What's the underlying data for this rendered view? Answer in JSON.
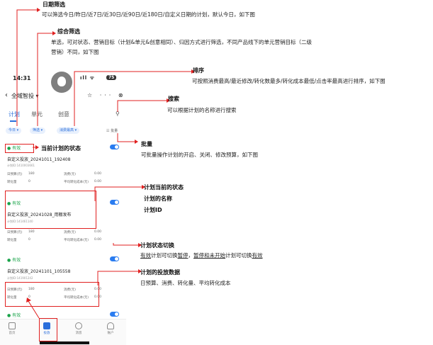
{
  "annotations": {
    "date_filter": {
      "title": "日期筛选",
      "desc": "可以筛选今日/昨日/近7日/近30日/近90日/近180日/自定义日期的计划，默认今日，如下图"
    },
    "combined_filter": {
      "title": "综合筛选",
      "desc1": "单选，可对状态、营销目标（计划&单元&创意相同）、归因方式进行筛选，不同产品线下的单元营销目标（二级",
      "desc2": "营销）不同，如下图"
    },
    "sort": {
      "title": "排序",
      "desc": "可按照消费最高/最近修改/转化数最多/转化成本最低/点击率最高进行排序，如下图"
    },
    "search": {
      "title": "搜索",
      "desc": "可以根据计划的名称进行搜索"
    },
    "current_status": "当前计划的状态",
    "batch": {
      "title": "批量",
      "desc": "可批量操作计划的开启、关闭、修改预算，如下图"
    },
    "plan_info": {
      "line1": "计划当前的状态",
      "line2": "计划的名称",
      "line3": "计划ID"
    },
    "toggle_switch": {
      "title": "计划状态切换",
      "desc_a": "有效",
      "desc_b": "计划可切换",
      "desc_c": "暂停",
      "desc_d": "，",
      "desc_e": "暂停和未开始",
      "desc_f": "计划可切换",
      "desc_g": "有效"
    },
    "delivery_data": {
      "title": "计划的投放数据",
      "desc": "日预算、消费、转化量、平均转化成本"
    }
  },
  "phone": {
    "time": "14:31",
    "signal": "ıll ᯤ",
    "battery": "75",
    "nav_back": "‹",
    "nav_title": "全域智投 ▾",
    "nav_icons": "☆ ··· ⊗",
    "tabs": [
      "计划",
      "单元",
      "创意"
    ],
    "filters": [
      "今日 ▾",
      "筛选 ▾",
      "消费最高 ▾"
    ],
    "batch_label": "☷ 批量",
    "cards": [
      {
        "status": "● 有效",
        "name": "自定义投放_20241011_192408",
        "id": "计划ID:1410003661",
        "m1_label": "日预算(元)",
        "m1_value": "180",
        "m2_label": "消费(元)",
        "m2_value": "0.00",
        "m3_label": "转化量",
        "m3_value": "0",
        "m4_label": "平均转化成本(元)",
        "m4_value": "0.00"
      },
      {
        "status": "● 有效",
        "name": "自定义投放_20241028_用棚发布",
        "id": "计划ID:141461140",
        "m1_label": "日预算(元)",
        "m1_value": "180",
        "m2_label": "消费(元)",
        "m2_value": "0.00",
        "m3_label": "转化量",
        "m3_value": "0",
        "m4_label": "平均转化成本(元)",
        "m4_value": "0.00"
      },
      {
        "status": "● 有效",
        "name": "自定义投放_20241101_105558",
        "id": "计划ID:141901242",
        "m1_label": "日预算(元)",
        "m1_value": "180",
        "m2_label": "消费(元)",
        "m2_value": "0.00",
        "m3_label": "转化量",
        "m3_value": "0",
        "m4_label": "平均转化成本(元)",
        "m4_value": "0.00"
      }
    ],
    "last_status": "● 有效",
    "tabbar": [
      "首页",
      "投放",
      "消息",
      "账户"
    ]
  }
}
